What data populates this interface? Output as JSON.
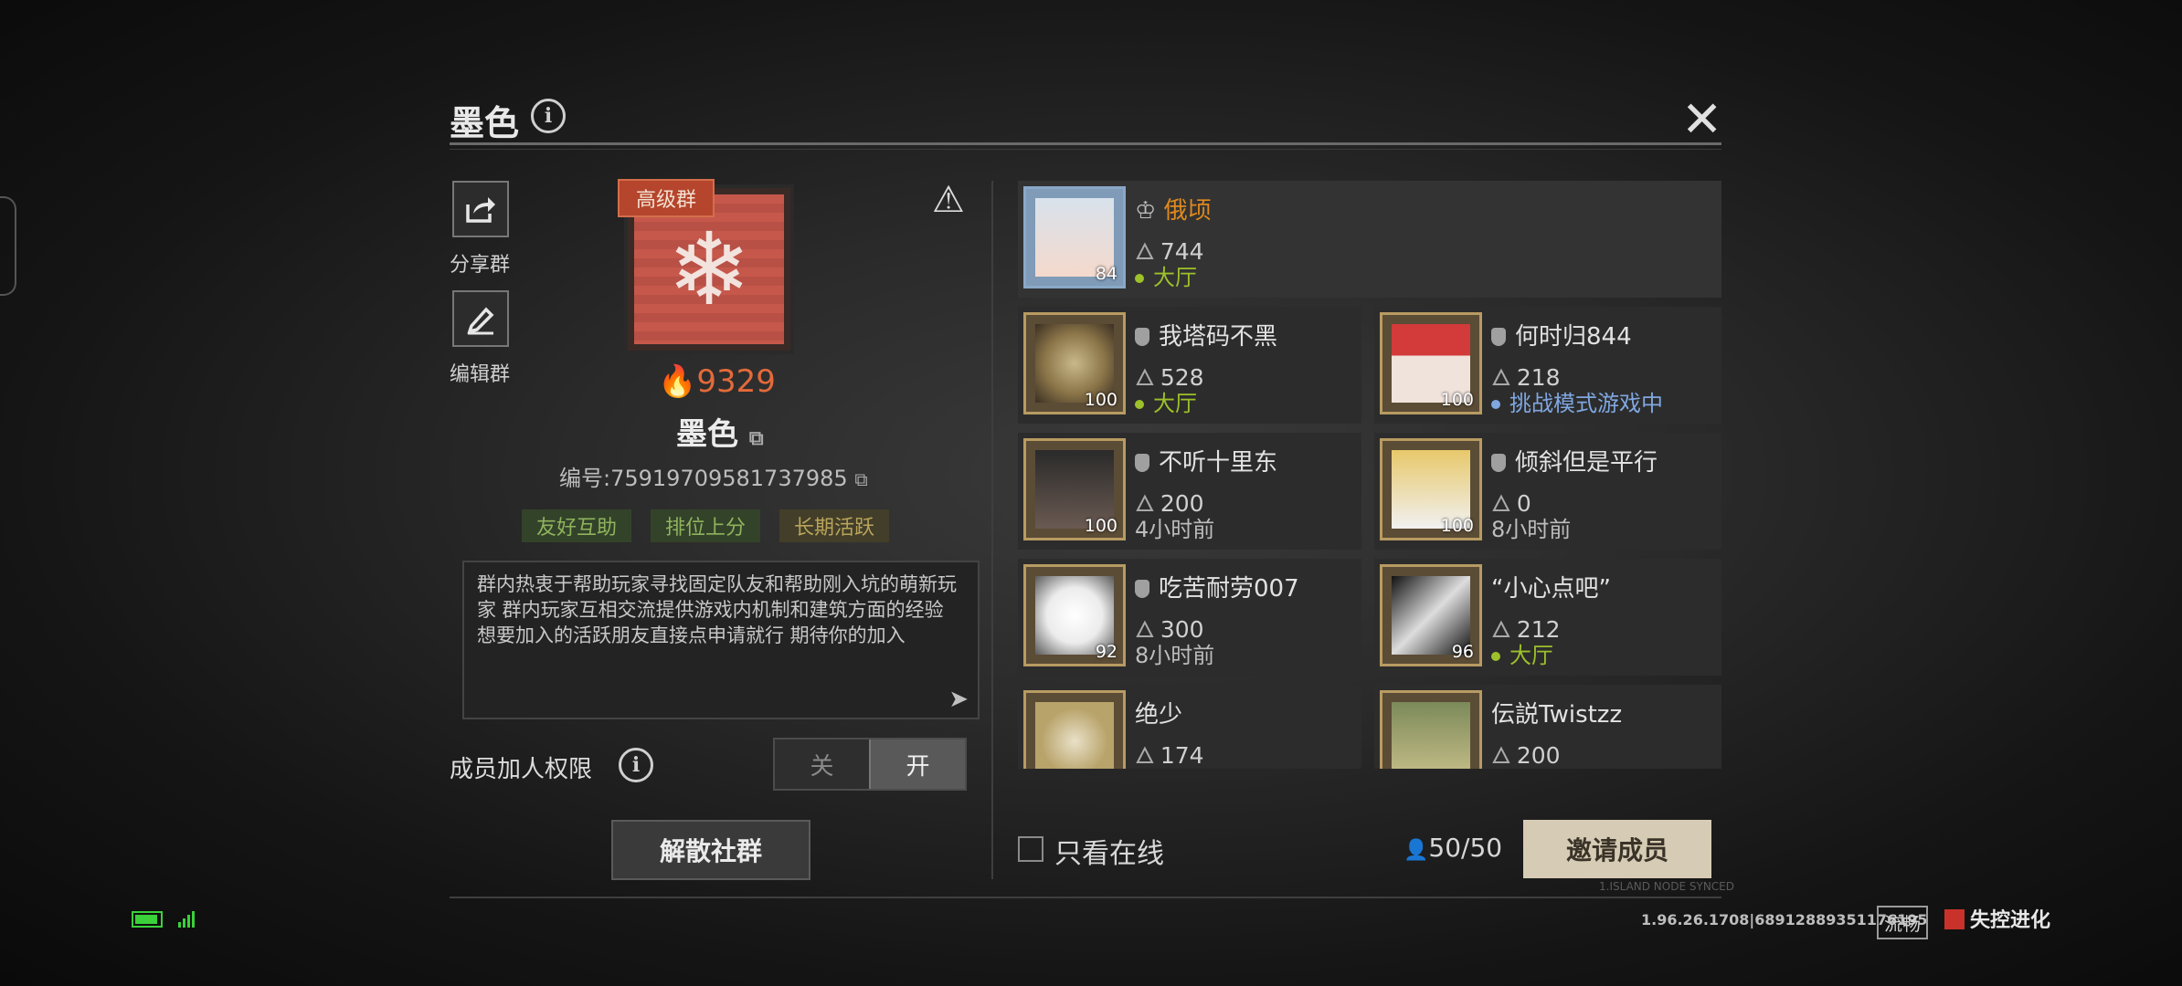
{
  "header": {
    "title": "墨色",
    "info_icon": "info-icon",
    "close_icon": "close-icon",
    "close_glyph": "✕"
  },
  "sidebar": {
    "share": {
      "label": "分享群",
      "icon": "share-icon"
    },
    "edit": {
      "label": "编辑群",
      "icon": "edit-icon"
    }
  },
  "group": {
    "badge": "高级群",
    "score": "9329",
    "name": "墨色",
    "id_text": "编号:7591970958173798​5",
    "tags": [
      "友好互助",
      "排位上分",
      "长期活跃"
    ],
    "description": "群内热衷于帮助玩家寻找固定队友和帮助刚入坑的萌新玩家  群内玩家互相交流提供游戏内机制和建筑方面的经验  想要加入的活跃朋友直接点申请就行 期待你的加入"
  },
  "permissions": {
    "label": "成员加人权限",
    "off": "关",
    "on": "开",
    "selected": "on"
  },
  "dissolve_button": "解散社群",
  "members": [
    {
      "name": "俄顷",
      "score": "744",
      "status": "大厅",
      "level": "84",
      "owner": true
    },
    {
      "name": "我塔码不黑",
      "score": "528",
      "status": "大厅",
      "level": "100"
    },
    {
      "name": "何时归844",
      "score": "218",
      "status": "挑战模式游戏中",
      "level": "100"
    },
    {
      "name": "不听十里东",
      "score": "200",
      "status": "4小时前",
      "level": "100"
    },
    {
      "name": "倾斜但是平行",
      "score": "0",
      "status": "8小时前",
      "level": "100"
    },
    {
      "name": "吃苦耐劳007",
      "score": "300",
      "status": "8小时前",
      "level": "92"
    },
    {
      "name": "“小心点吧”",
      "score": "212",
      "status": "大厅",
      "level": "96"
    },
    {
      "name": "绝少",
      "score": "174",
      "status": "",
      "level": ""
    },
    {
      "name": "伝説Twistzz",
      "score": "200",
      "status": "",
      "level": ""
    }
  ],
  "footer": {
    "online_only": "只看在线",
    "member_count": "50/50",
    "invite": "邀请成员",
    "version": "1.96.26.1708|68912889351176195",
    "island_note": "1.ISLAND NODE SYNCED",
    "smooth": "流畅",
    "brand": "失控进化"
  },
  "colors": {
    "online": "#9dc12a",
    "challenge": "#7fa7e0",
    "owner_name": "#e08a1e",
    "accent": "#e36a3a"
  }
}
